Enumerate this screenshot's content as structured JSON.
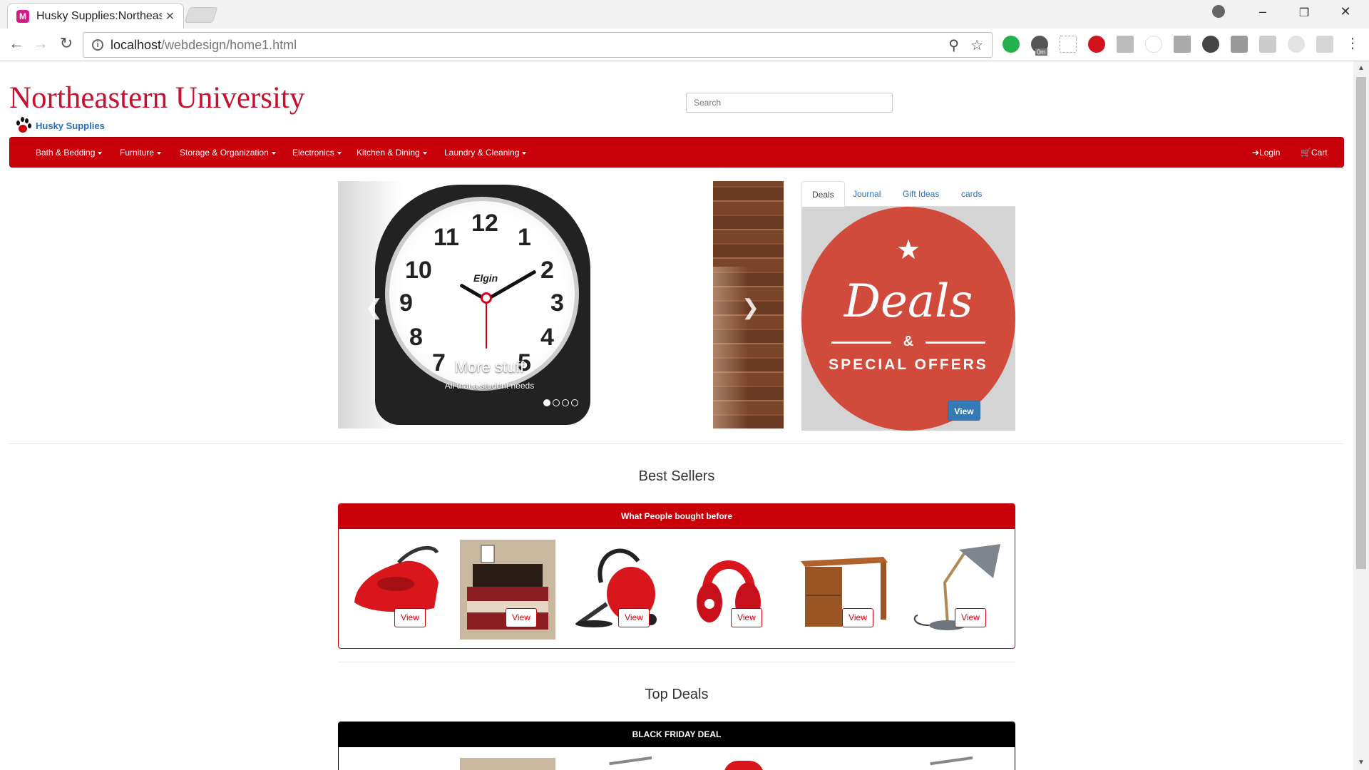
{
  "browser": {
    "tab_title": "Husky Supplies:Northeastern",
    "tab_favicon": "M",
    "url_host": "localhost",
    "url_path": "/webdesign/home1.html",
    "ext_badge": "0m"
  },
  "header": {
    "brand": "Northeastern University",
    "sub_brand": "Husky Supplies",
    "search_placeholder": "Search"
  },
  "navbar": {
    "items": [
      "Bath & Bedding",
      "Furniture",
      "Storage & Organization",
      "Electronics",
      "Kitchen & Dining",
      "Laundry & Cleaning"
    ],
    "login": "Login",
    "cart": "Cart"
  },
  "carousel": {
    "caption_title": "More stuff",
    "caption_sub": "All that a student needs",
    "clock_brand": "Elgin",
    "clock_numbers": [
      "12",
      "1",
      "2",
      "3",
      "4",
      "5",
      "7",
      "8",
      "9",
      "10",
      "11"
    ],
    "slides": 4,
    "active_slide": 1
  },
  "tabs": {
    "items": [
      "Deals",
      "Journal",
      "Gift Ideas",
      "cards"
    ],
    "active": "Deals"
  },
  "deal": {
    "title": "Deals",
    "amp": "&",
    "subtitle": "SPECIAL OFFERS",
    "view": "View"
  },
  "best_sellers": {
    "title": "Best Sellers",
    "panel_heading": "What People bought before",
    "view_label": "View",
    "products": [
      "steam-iron",
      "bedding-set",
      "vacuum-cleaner",
      "headphones",
      "desk",
      "desk-lamp"
    ]
  },
  "top_deals": {
    "title": "Top Deals",
    "panel_heading": "BLACK FRIDAY DEAL"
  },
  "colors": {
    "brand_red": "#c8000a",
    "link_blue": "#2a6ebb",
    "deal_red": "#d14b3d"
  }
}
